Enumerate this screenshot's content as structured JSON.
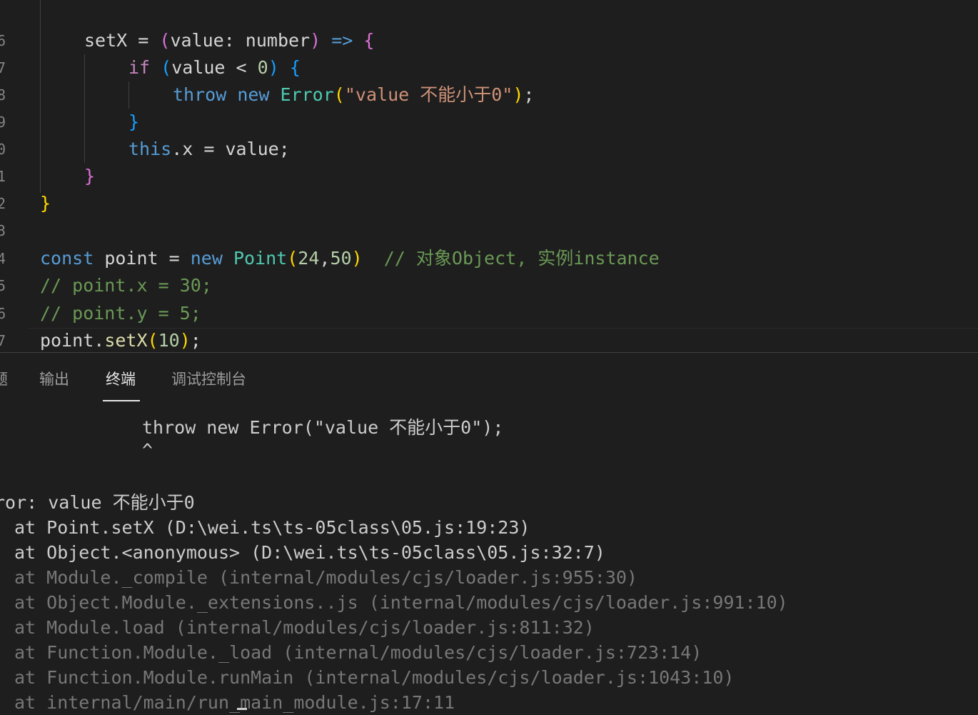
{
  "editor": {
    "lines": [
      {
        "gutter": "6",
        "tokens": [
          [
            "var",
            "setX "
          ],
          [
            "var",
            "= "
          ],
          [
            "br2",
            "("
          ],
          [
            "var",
            "value: "
          ],
          [
            "var",
            "number"
          ],
          [
            "br2",
            ")"
          ],
          [
            "var",
            " "
          ],
          [
            "kw",
            "=>"
          ],
          [
            "var",
            " "
          ],
          [
            "br2",
            "{"
          ]
        ]
      },
      {
        "gutter": "7",
        "tokens": [
          [
            "kw2",
            "if "
          ],
          [
            "br3",
            "("
          ],
          [
            "var",
            "value "
          ],
          [
            "var",
            "< "
          ],
          [
            "num",
            "0"
          ],
          [
            "br3",
            ")"
          ],
          [
            "var",
            " "
          ],
          [
            "br3",
            "{"
          ]
        ]
      },
      {
        "gutter": "8",
        "tokens": [
          [
            "kw",
            "throw "
          ],
          [
            "kw",
            "new "
          ],
          [
            "ty",
            "Error"
          ],
          [
            "br1",
            "("
          ],
          [
            "str",
            "\"value 不能小于0\""
          ],
          [
            "br1",
            ")"
          ],
          [
            "var",
            ";"
          ]
        ]
      },
      {
        "gutter": "9",
        "tokens": [
          [
            "br3",
            "}"
          ]
        ]
      },
      {
        "gutter": "0",
        "tokens": [
          [
            "kw",
            "this"
          ],
          [
            "var",
            ".x = value;"
          ]
        ]
      },
      {
        "gutter": "1",
        "tokens": [
          [
            "br2",
            "}"
          ]
        ]
      },
      {
        "gutter": "2",
        "tokens": [
          [
            "br1",
            "}"
          ]
        ]
      },
      {
        "gutter": "3",
        "tokens": []
      },
      {
        "gutter": "4",
        "tokens": [
          [
            "kw",
            "const "
          ],
          [
            "var",
            "point "
          ],
          [
            "var",
            "= "
          ],
          [
            "kw",
            "new "
          ],
          [
            "ty",
            "Point"
          ],
          [
            "br1",
            "("
          ],
          [
            "num",
            "24"
          ],
          [
            "var",
            ","
          ],
          [
            "num",
            "50"
          ],
          [
            "br1",
            ")"
          ],
          [
            "var",
            "  "
          ],
          [
            "cm",
            "// 对象Object, 实例instance"
          ]
        ]
      },
      {
        "gutter": "5",
        "tokens": [
          [
            "cm",
            "// point.x = 30;"
          ]
        ]
      },
      {
        "gutter": "6",
        "tokens": [
          [
            "cm",
            "// point.y = 5;"
          ]
        ]
      },
      {
        "gutter": "7",
        "tokens": [
          [
            "var",
            "point."
          ],
          [
            "fn",
            "setX"
          ],
          [
            "br1",
            "("
          ],
          [
            "num",
            "10"
          ],
          [
            "br1",
            ")"
          ],
          [
            "var",
            ";"
          ]
        ]
      }
    ]
  },
  "panel": {
    "tabs": [
      {
        "label": "题",
        "active": false
      },
      {
        "label": "输出",
        "active": false
      },
      {
        "label": "终端",
        "active": true
      },
      {
        "label": "调试控制台",
        "active": false
      }
    ],
    "terminal": [
      {
        "text": "throw new Error(\"value 不能小于0\");",
        "dim": false
      },
      {
        "text": "^",
        "dim": false
      },
      {
        "text": "",
        "dim": false
      },
      {
        "text": "ror: value 不能小于0",
        "dim": false
      },
      {
        "text": "at Point.setX (D:\\wei.ts\\ts-05class\\05.js:19:23)",
        "dim": false
      },
      {
        "text": "at Object.<anonymous> (D:\\wei.ts\\ts-05class\\05.js:32:7)",
        "dim": false
      },
      {
        "text": "at Module._compile (internal/modules/cjs/loader.js:955:30)",
        "dim": true
      },
      {
        "text": "at Object.Module._extensions..js (internal/modules/cjs/loader.js:991:10)",
        "dim": true
      },
      {
        "text": "at Module.load (internal/modules/cjs/loader.js:811:32)",
        "dim": true
      },
      {
        "text": "at Function.Module._load (internal/modules/cjs/loader.js:723:14)",
        "dim": true
      },
      {
        "text": "at Function.Module.runMain (internal/modules/cjs/loader.js:1043:10)",
        "dim": true
      },
      {
        "text": "at internal/main/run_main_module.js:17:11",
        "dim": true
      }
    ]
  }
}
